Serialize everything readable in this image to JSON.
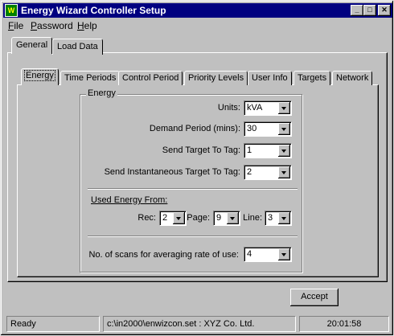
{
  "window": {
    "title": "Energy Wizard Controller Setup",
    "icon": "app-icon"
  },
  "menu": [
    {
      "label": "File",
      "mnemonic": "F",
      "rest": "ile"
    },
    {
      "label": "Password",
      "mnemonic": "P",
      "rest": "assword"
    },
    {
      "label": "Help",
      "mnemonic": "H",
      "rest": "elp"
    }
  ],
  "outer_tabs": [
    "General",
    "Load Data"
  ],
  "inner_tabs": [
    "Energy",
    "Time Periods",
    "Control Period",
    "Priority Levels",
    "User Info",
    "Targets",
    "Network"
  ],
  "energy": {
    "group_label": "Energy",
    "units": {
      "label": "Units:",
      "value": "kVA"
    },
    "demand_period": {
      "label": "Demand Period (mins):",
      "value": "30"
    },
    "send_target": {
      "label": "Send Target To Tag:",
      "value": "1"
    },
    "send_instant": {
      "label": "Send Instantaneous Target To Tag:",
      "value": "2"
    },
    "used_from_label": "Used Energy From:",
    "rec": {
      "label": "Rec:",
      "value": "2"
    },
    "page": {
      "label": "Page:",
      "value": "9"
    },
    "line": {
      "label": "Line:",
      "value": "3"
    },
    "scans": {
      "label": "No. of scans for averaging rate of use:",
      "value": "4"
    }
  },
  "accept_label": "Accept",
  "status": {
    "state": "Ready",
    "file": "c:\\in2000\\enwizcon.set : XYZ Co. Ltd.",
    "time": "20:01:58"
  }
}
